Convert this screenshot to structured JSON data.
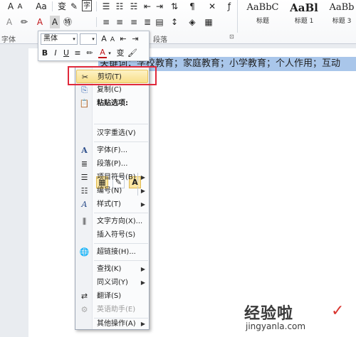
{
  "ribbon": {
    "font_group": "字体",
    "paragraph_group": "段落",
    "font_grow": "A",
    "font_shrink": "A",
    "change_case": "Aa",
    "phonetic": "变",
    "enclose": "字",
    "styles": [
      {
        "sample": "AaBbC",
        "name": "标题"
      },
      {
        "sample": "AaBl",
        "name": "标题 1"
      },
      {
        "sample": "AaBb",
        "name": "标题 3"
      }
    ]
  },
  "mini_toolbar": {
    "font_name": "黑体",
    "font_size": "",
    "bold": "B",
    "italic": "I",
    "underline": "U",
    "font_color": "A"
  },
  "document": {
    "selected_text": "关键词：学校教育；家庭教育；小学教育；个人作用；互动"
  },
  "context_menu": {
    "items": {
      "cut": "剪切(T)",
      "copy": "复制(C)",
      "paste_options": "粘贴选项:",
      "reconvert": "汉字重选(V)",
      "font": "字体(F)...",
      "paragraph": "段落(P)...",
      "bullets": "项目符号(B)",
      "numbering": "编号(N)",
      "styles": "样式(T)",
      "text_direction": "文字方向(X)...",
      "insert_symbol": "插入符号(S)",
      "hyperlink": "超链接(H)...",
      "lookup": "查找(K)",
      "synonyms": "同义词(Y)",
      "translate": "翻译(S)",
      "english_assistant": "英语助手(E)",
      "more_actions": "其他操作(A)"
    },
    "paste_buttons": [
      "keep-source-formatting",
      "merge-formatting",
      "keep-text-only"
    ],
    "paste_text_only_glyph": "A"
  },
  "watermark": {
    "name": "经验啦",
    "url": "jingyanla.com"
  },
  "colors": {
    "highlight_box": "#e0293b",
    "selection": "#a9c6ea",
    "menu_hover": "#f8df8a"
  }
}
